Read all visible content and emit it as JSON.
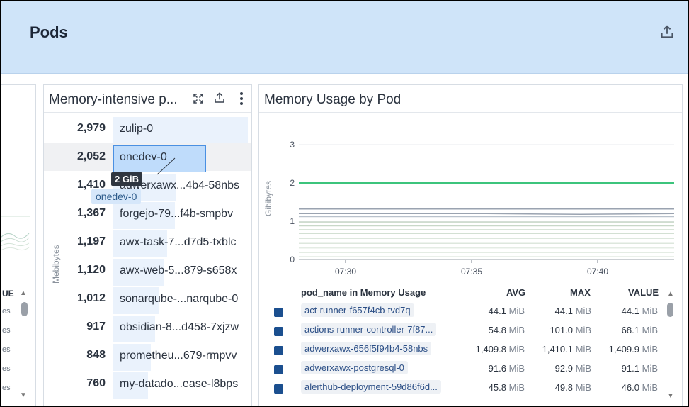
{
  "header": {
    "title": "Pods"
  },
  "left_panel": {
    "partial_header": "UE",
    "partial_rows": [
      "es",
      "es",
      "es",
      "es",
      "es"
    ]
  },
  "memory_panel": {
    "title": "Memory-intensive p...",
    "y_axis_label": "Mebibytes",
    "bars": [
      {
        "value": "2,979",
        "name": "zulip-0",
        "fraction": 1.0
      },
      {
        "value": "2,052",
        "name": "onedev-0",
        "fraction": 0.69
      },
      {
        "value": "1,410",
        "name": "adwerxawx...4b4-58nbs",
        "fraction": 0.47
      },
      {
        "value": "1,367",
        "name": "forgejo-79...f4b-smpbv",
        "fraction": 0.46
      },
      {
        "value": "1,197",
        "name": "awx-task-7...d7d5-txblc",
        "fraction": 0.4
      },
      {
        "value": "1,120",
        "name": "awx-web-5...879-s658x",
        "fraction": 0.38
      },
      {
        "value": "1,012",
        "name": "sonarqube-...narqube-0",
        "fraction": 0.34
      },
      {
        "value": "917",
        "name": "obsidian-8...d458-7xjzw",
        "fraction": 0.31
      },
      {
        "value": "848",
        "name": "prometheu...679-rmpvv",
        "fraction": 0.28
      },
      {
        "value": "760",
        "name": "my-datado...ease-l8bps",
        "fraction": 0.26
      }
    ],
    "tooltip": {
      "value": "2 GiB",
      "name": "onedev-0"
    }
  },
  "usage_panel": {
    "title": "Memory Usage by Pod",
    "chart_data": {
      "type": "line",
      "ylabel": "Gibibytes",
      "ylim": [
        0,
        3
      ],
      "y_ticks": [
        "3",
        "2",
        "1",
        "0"
      ],
      "x_ticks": [
        "07:30",
        "07:35",
        "07:40"
      ],
      "series": [
        {
          "color": "#3cc47c",
          "values": [
            2.0,
            2.0,
            2.0,
            2.0,
            2.0
          ]
        },
        {
          "color": "#9aa3b0",
          "values": [
            1.32,
            1.32,
            1.32,
            1.32,
            1.32
          ]
        },
        {
          "color": "#9aa3b0",
          "values": [
            1.2,
            1.2,
            1.2,
            1.18,
            1.2
          ]
        },
        {
          "color": "#b9c2cc",
          "values": [
            1.12,
            1.12,
            1.12,
            1.12,
            1.12
          ]
        },
        {
          "color": "#c8d8c8",
          "values": [
            0.98,
            0.98,
            0.98,
            0.98,
            0.98
          ]
        },
        {
          "color": "#c8d8c8",
          "values": [
            0.88,
            0.88,
            0.88,
            0.88,
            0.88
          ]
        },
        {
          "color": "#d3e0d3",
          "values": [
            0.78,
            0.78,
            0.78,
            0.78,
            0.78
          ]
        },
        {
          "color": "#d3e0d3",
          "values": [
            0.68,
            0.68,
            0.68,
            0.68,
            0.68
          ]
        },
        {
          "color": "#dde7dd",
          "values": [
            0.55,
            0.55,
            0.55,
            0.55,
            0.55
          ]
        },
        {
          "color": "#dde7dd",
          "values": [
            0.42,
            0.42,
            0.42,
            0.42,
            0.42
          ]
        },
        {
          "color": "#e4ece4",
          "values": [
            0.3,
            0.3,
            0.3,
            0.3,
            0.3
          ]
        },
        {
          "color": "#e4ece4",
          "values": [
            0.18,
            0.18,
            0.18,
            0.18,
            0.18
          ]
        },
        {
          "color": "#eaf0ea",
          "values": [
            0.08,
            0.08,
            0.08,
            0.08,
            0.08
          ]
        }
      ]
    },
    "legend": {
      "headers": {
        "name": "pod_name in Memory Usage",
        "avg": "AVG",
        "max": "MAX",
        "value": "VALUE"
      },
      "unit": "MiB",
      "rows": [
        {
          "name": "act-runner-f657f4cb-tvd7q",
          "avg": "44.1",
          "max": "44.1",
          "value": "44.1"
        },
        {
          "name": "actions-runner-controller-7f87...",
          "avg": "54.8",
          "max": "101.0",
          "value": "68.1"
        },
        {
          "name": "adwerxawx-656f5f94b4-58nbs",
          "avg": "1,409.8",
          "max": "1,410.1",
          "value": "1,409.9"
        },
        {
          "name": "adwerxawx-postgresql-0",
          "avg": "91.6",
          "max": "92.9",
          "value": "91.1"
        },
        {
          "name": "alerthub-deployment-59d86f6d...",
          "avg": "45.8",
          "max": "49.8",
          "value": "46.0"
        }
      ]
    }
  }
}
